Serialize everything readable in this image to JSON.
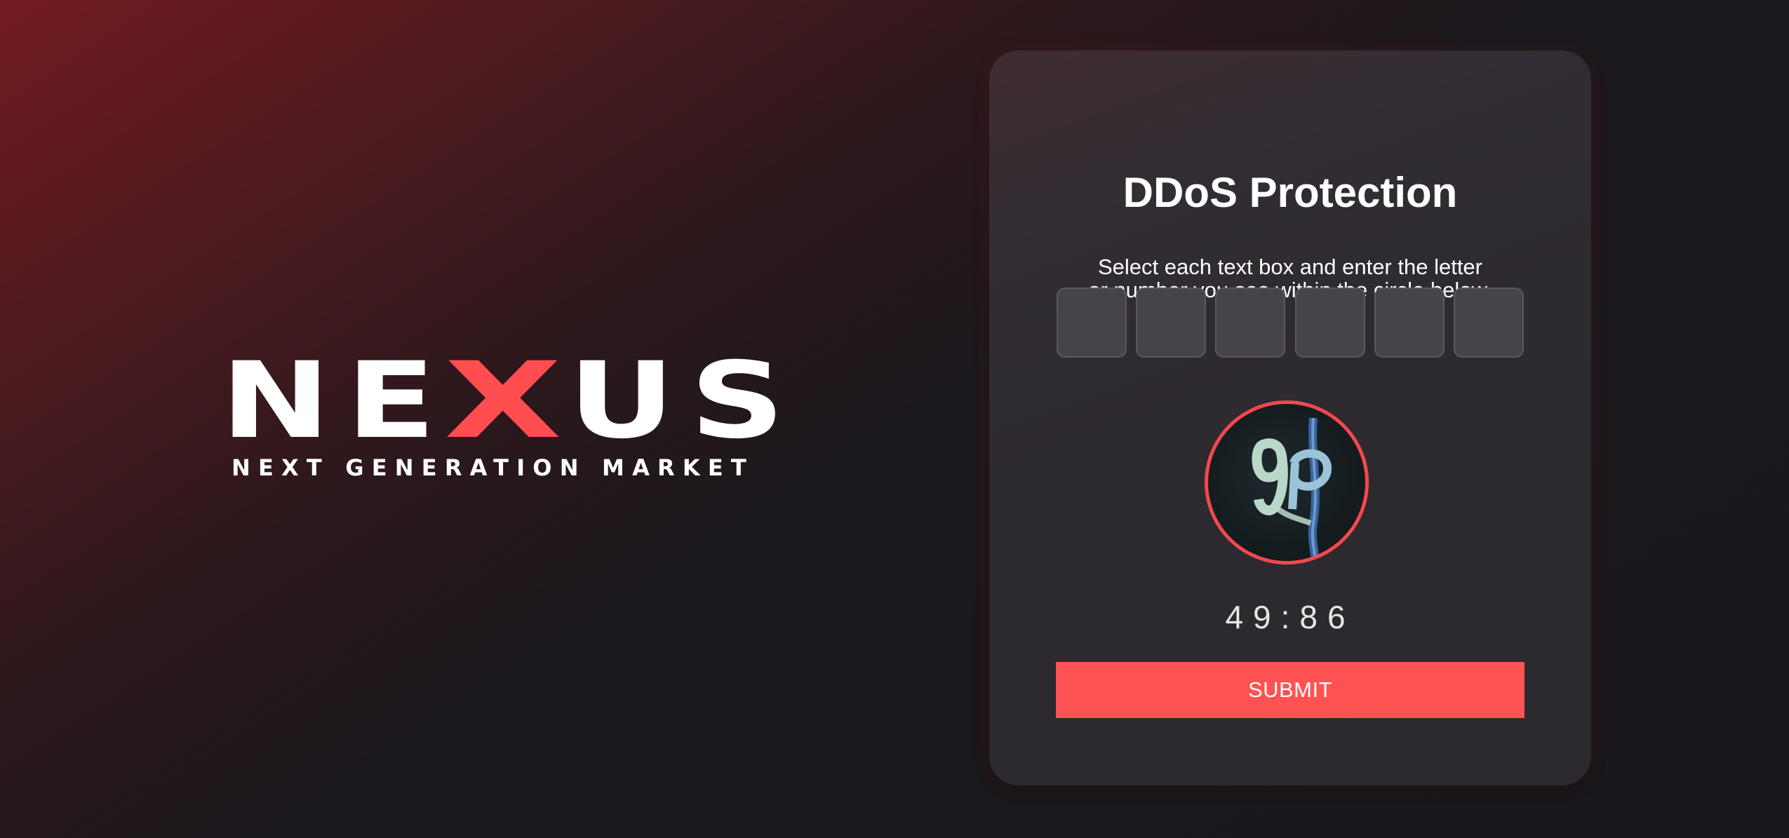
{
  "logo": {
    "letters": [
      "N",
      "E",
      "X",
      "U",
      "S"
    ],
    "accent_letter_index": 2,
    "tagline": "NEXT GENERATION MARKET"
  },
  "card": {
    "title": "DDoS Protection",
    "instruction_line1": "Select each text box and enter the letter",
    "instruction_line2": "or number you see within the circle below.",
    "code_boxes": [
      "",
      "",
      "",
      "",
      "",
      ""
    ],
    "captcha_image": "captcha-circle",
    "timer": "49:86",
    "submit_label": "SUBMIT"
  },
  "colors": {
    "accent": "#ff5252",
    "card_background": "#2d2a30",
    "page_background": "#1a181d",
    "gradient_red": "#721b20"
  }
}
